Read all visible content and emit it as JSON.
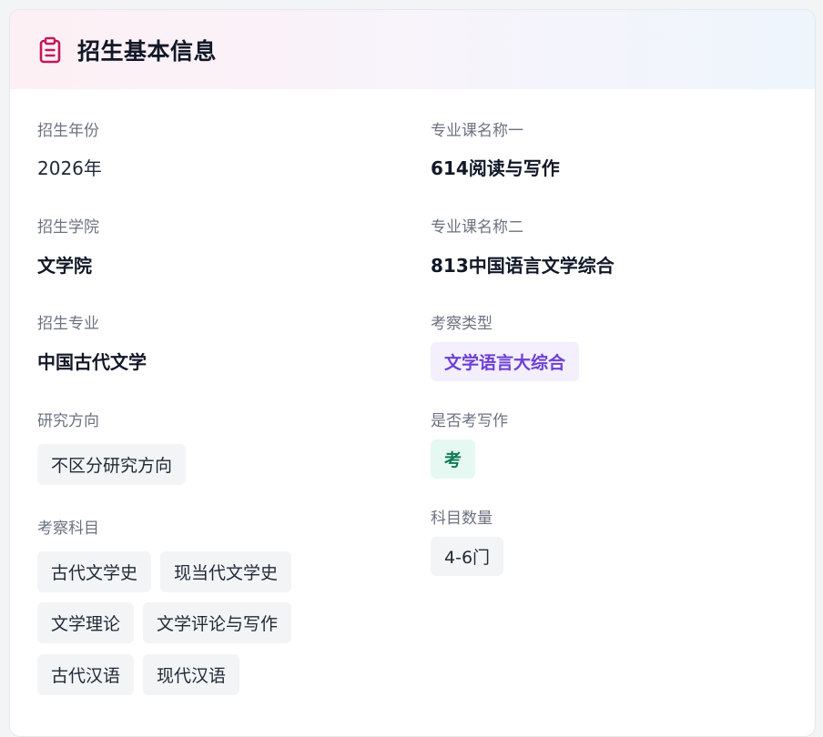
{
  "card": {
    "title": "招生基本信息",
    "icon": "clipboard-icon",
    "accent_color": "#c2185b"
  },
  "left": {
    "year": {
      "label": "招生年份",
      "value": "2026年"
    },
    "college": {
      "label": "招生学院",
      "value": "文学院"
    },
    "major": {
      "label": "招生专业",
      "value": "中国古代文学"
    },
    "direction": {
      "label": "研究方向",
      "tags": [
        "不区分研究方向"
      ]
    },
    "subjects": {
      "label": "考察科目",
      "tags": [
        "古代文学史",
        "现当代文学史",
        "文学理论",
        "文学评论与写作",
        "古代汉语",
        "现代汉语"
      ]
    }
  },
  "right": {
    "course1": {
      "label": "专业课名称一",
      "value": "614阅读与写作"
    },
    "course2": {
      "label": "专业课名称二",
      "value": "813中国语言文学综合"
    },
    "exam_type": {
      "label": "考察类型",
      "value": "文学语言大综合",
      "color": "#6d3fd4"
    },
    "writing": {
      "label": "是否考写作",
      "value": "考",
      "color": "#0f7a55"
    },
    "subject_count": {
      "label": "科目数量",
      "value": "4-6门"
    }
  }
}
